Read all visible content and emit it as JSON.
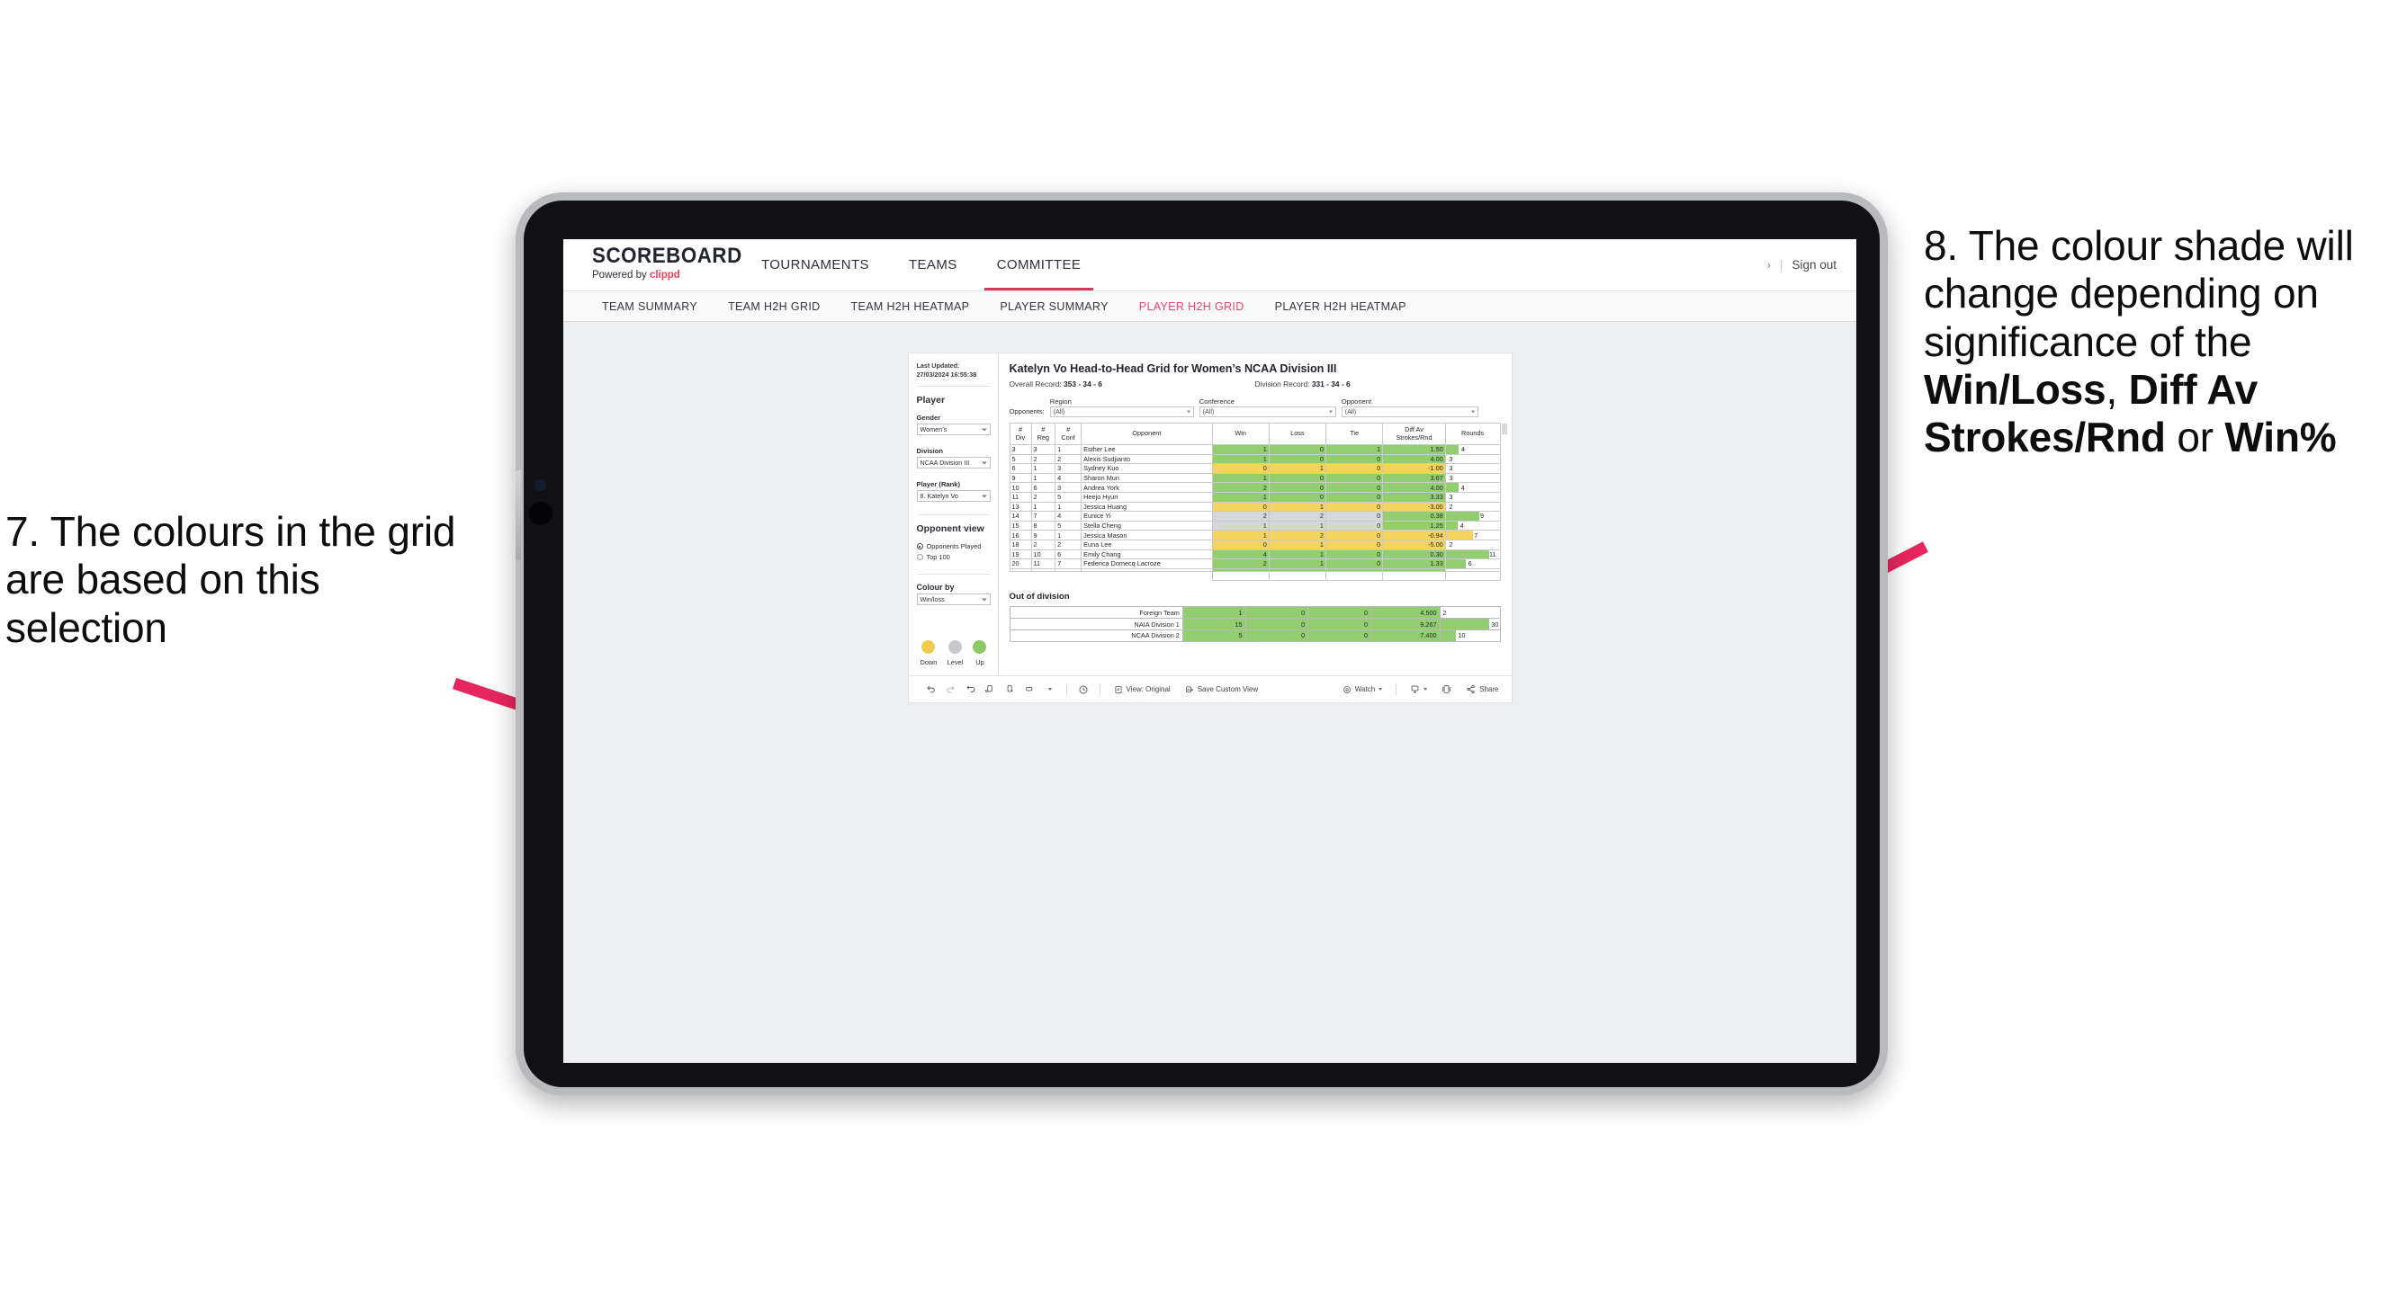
{
  "annotations": {
    "left": "7. The colours in the grid are based on this selection",
    "right_parts": [
      {
        "t": "8. The colour shade will change depending on significance of the ",
        "b": false
      },
      {
        "t": "Win/Loss",
        "b": true
      },
      {
        "t": ", ",
        "b": false
      },
      {
        "t": "Diff Av Strokes/Rnd",
        "b": true
      },
      {
        "t": " or ",
        "b": false
      },
      {
        "t": "Win%",
        "b": true
      }
    ],
    "arrow_color": "#e8265e"
  },
  "header": {
    "brand_title": "SCOREBOARD",
    "brand_sub_prefix": "Powered by ",
    "brand_sub_name": "clippd",
    "nav": [
      {
        "label": "TOURNAMENTS",
        "active": false
      },
      {
        "label": "TEAMS",
        "active": false
      },
      {
        "label": "COMMITTEE",
        "active": true
      }
    ],
    "chevron": "›",
    "pipe": "|",
    "signout": "Sign out"
  },
  "subnav": [
    {
      "label": "TEAM SUMMARY",
      "active": false
    },
    {
      "label": "TEAM H2H GRID",
      "active": false
    },
    {
      "label": "TEAM H2H HEATMAP",
      "active": false
    },
    {
      "label": "PLAYER SUMMARY",
      "active": false
    },
    {
      "label": "PLAYER H2H GRID",
      "active": true
    },
    {
      "label": "PLAYER H2H HEATMAP",
      "active": false
    }
  ],
  "sidebar": {
    "last_updated": "Last Updated: 27/03/2024 16:55:38",
    "player_heading": "Player",
    "gender_label": "Gender",
    "gender_value": "Women’s",
    "division_label": "Division",
    "division_value": "NCAA Division III",
    "player_rank_label": "Player (Rank)",
    "player_rank_value": "8. Katelyn Vo",
    "opponent_view_heading": "Opponent view",
    "opponent_view_options": [
      {
        "label": "Opponents Played",
        "selected": true
      },
      {
        "label": "Top 100",
        "selected": false
      }
    ],
    "colour_by_label": "Colour by",
    "colour_by_value": "Win/loss",
    "legend": [
      {
        "label": "Down",
        "color": "#f2cc4e"
      },
      {
        "label": "Level",
        "color": "#c6c8cb"
      },
      {
        "label": "Up",
        "color": "#8cc863"
      }
    ]
  },
  "main": {
    "title": "Katelyn Vo Head-to-Head Grid for Women’s NCAA Division III",
    "overall_record_label": "Overall Record: ",
    "overall_record_value": "353 - 34 - 6",
    "division_record_label": "Division Record: ",
    "division_record_value": "331 - 34 - 6",
    "opponents_tag": "Opponents:",
    "filters": [
      {
        "label": "Region",
        "value": "(All)"
      },
      {
        "label": "Conference",
        "value": "(All)"
      },
      {
        "label": "Opponent",
        "value": "(All)"
      }
    ],
    "columns": [
      "# Div",
      "# Reg",
      "# Conf",
      "Opponent",
      "Win",
      "Loss",
      "Tie",
      "Diff Av Strokes/Rnd",
      "Rounds"
    ],
    "column_lines": [
      [
        "#",
        "Div"
      ],
      [
        "#",
        "Reg"
      ],
      [
        "#",
        "Conf"
      ],
      [
        "Opponent",
        ""
      ],
      [
        "Win",
        ""
      ],
      [
        "Loss",
        ""
      ],
      [
        "Tie",
        ""
      ],
      [
        "Diff Av",
        "Strokes/Rnd"
      ],
      [
        "Rounds",
        ""
      ]
    ],
    "rows": [
      {
        "div": "3",
        "reg": "3",
        "conf": "1",
        "opponent": "Esther Lee",
        "win": "1",
        "loss": "0",
        "tie": "1",
        "diff": "1.50",
        "rounds": "4",
        "color": "green",
        "bar": 24
      },
      {
        "div": "5",
        "reg": "2",
        "conf": "2",
        "opponent": "Alexis Sudjianto",
        "win": "1",
        "loss": "0",
        "tie": "0",
        "diff": "4.00",
        "rounds": "3",
        "color": "green",
        "bar": 0
      },
      {
        "div": "6",
        "reg": "1",
        "conf": "3",
        "opponent": "Sydney Kuo",
        "win": "0",
        "loss": "1",
        "tie": "0",
        "diff": "-1.00",
        "rounds": "3",
        "color": "yellow",
        "bar": 0
      },
      {
        "div": "9",
        "reg": "1",
        "conf": "4",
        "opponent": "Sharon Mun",
        "win": "1",
        "loss": "0",
        "tie": "0",
        "diff": "3.67",
        "rounds": "3",
        "color": "green",
        "bar": 0
      },
      {
        "div": "10",
        "reg": "6",
        "conf": "3",
        "opponent": "Andrea York",
        "win": "2",
        "loss": "0",
        "tie": "0",
        "diff": "4.00",
        "rounds": "4",
        "color": "green",
        "bar": 24
      },
      {
        "div": "11",
        "reg": "2",
        "conf": "5",
        "opponent": "Heejo Hyun",
        "win": "1",
        "loss": "0",
        "tie": "0",
        "diff": "3.33",
        "rounds": "3",
        "color": "green",
        "bar": 0
      },
      {
        "div": "13",
        "reg": "1",
        "conf": "1",
        "opponent": "Jessica Huang",
        "win": "0",
        "loss": "1",
        "tie": "0",
        "diff": "-3.00",
        "rounds": "2",
        "color": "yellow",
        "bar": 0
      },
      {
        "div": "14",
        "reg": "7",
        "conf": "4",
        "opponent": "Eunice Yi",
        "win": "2",
        "loss": "2",
        "tie": "0",
        "diff": "0.38",
        "rounds": "9",
        "color": "grey",
        "bar": 62,
        "diffcolor": "green"
      },
      {
        "div": "15",
        "reg": "8",
        "conf": "5",
        "opponent": "Stella Cheng",
        "win": "1",
        "loss": "1",
        "tie": "0",
        "diff": "1.25",
        "rounds": "4",
        "color": "grey",
        "bar": 22,
        "diffcolor": "green"
      },
      {
        "div": "16",
        "reg": "9",
        "conf": "1",
        "opponent": "Jessica Mason",
        "win": "1",
        "loss": "2",
        "tie": "0",
        "diff": "-0.94",
        "rounds": "7",
        "color": "yellow",
        "bar": 50
      },
      {
        "div": "18",
        "reg": "2",
        "conf": "2",
        "opponent": "Euna Lee",
        "win": "0",
        "loss": "1",
        "tie": "0",
        "diff": "-5.00",
        "rounds": "2",
        "color": "yellow",
        "bar": 0
      },
      {
        "div": "19",
        "reg": "10",
        "conf": "6",
        "opponent": "Emily Chang",
        "win": "4",
        "loss": "1",
        "tie": "0",
        "diff": "0.30",
        "rounds": "11",
        "color": "green",
        "bar": 80
      },
      {
        "div": "20",
        "reg": "11",
        "conf": "7",
        "opponent": "Federica Domecq Lacroze",
        "win": "2",
        "loss": "1",
        "tie": "0",
        "diff": "1.33",
        "rounds": "6",
        "color": "green",
        "bar": 38
      }
    ],
    "out_of_division_title": "Out of division",
    "out_of_division_rows": [
      {
        "name": "Foreign Team",
        "win": "1",
        "loss": "0",
        "tie": "0",
        "diff": "4.500",
        "rounds": "2",
        "color": "green",
        "bar": 0
      },
      {
        "name": "NAIA Division 1",
        "win": "15",
        "loss": "0",
        "tie": "0",
        "diff": "9.267",
        "rounds": "30",
        "color": "green",
        "bar": 82
      },
      {
        "name": "NCAA Division 2",
        "win": "5",
        "loss": "0",
        "tie": "0",
        "diff": "7.400",
        "rounds": "10",
        "color": "green",
        "bar": 26
      }
    ]
  },
  "toolbar": {
    "view_original": "View: Original",
    "save_custom_view": "Save Custom View",
    "watch": "Watch",
    "share": "Share"
  }
}
